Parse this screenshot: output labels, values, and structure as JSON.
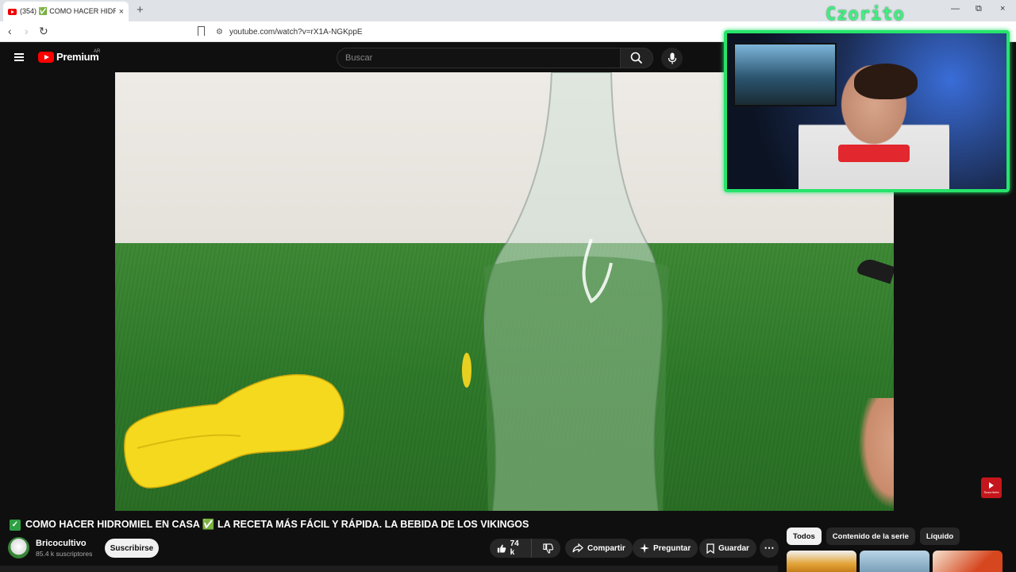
{
  "browser": {
    "tab": {
      "title": "(354) ✅ COMO HACER HIDR",
      "close_glyph": "×"
    },
    "new_tab_glyph": "+",
    "url": "youtube.com/watch?v=rX1A-NGKppE",
    "window_controls": {
      "minimize": "—",
      "restore": "⧉",
      "close": "×"
    },
    "nav": {
      "back": "‹",
      "forward": "›",
      "reload": "↻"
    }
  },
  "header": {
    "logo_text": "Premium",
    "region": "AR",
    "search_placeholder": "Buscar"
  },
  "overlay": {
    "streamer_name": "Czorito"
  },
  "video": {
    "title": "COMO HACER HIDROMIEL EN CASA ✅ LA RECETA MÁS FÁCIL Y RÁPIDA. LA BEBIDA DE LOS VIKINGOS",
    "check_glyph": "✓",
    "watermark_label": "Suscríbete"
  },
  "channel": {
    "name": "Bricocultivo",
    "subscribers": "85.4 k suscriptores",
    "subscribe_label": "Suscribirse"
  },
  "actions": {
    "likes": "74 k",
    "share": "Compartir",
    "ask": "Preguntar",
    "save": "Guardar",
    "more_glyph": "⋯"
  },
  "chips": [
    "Todos",
    "Contenido de la serie",
    "Líquido"
  ],
  "colors": {
    "overlay_border": "#27e36b",
    "yt_red": "#ff0000",
    "check_green": "#2ea043"
  }
}
